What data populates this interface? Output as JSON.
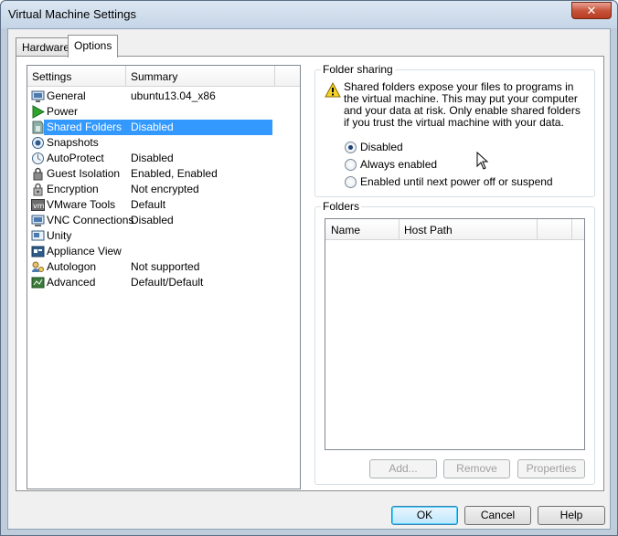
{
  "window": {
    "title": "Virtual Machine Settings",
    "close_glyph": "✕"
  },
  "tabs": [
    {
      "label": "Hardware",
      "active": false
    },
    {
      "label": "Options",
      "active": true
    }
  ],
  "settings": {
    "headers": {
      "settings": "Settings",
      "summary": "Summary"
    },
    "items": [
      {
        "label": "General",
        "summary": "ubuntu13.04_x86",
        "icon": "general-icon"
      },
      {
        "label": "Power",
        "summary": "",
        "icon": "power-icon"
      },
      {
        "label": "Shared Folders",
        "summary": "Disabled",
        "icon": "shared-folders-icon",
        "selected": true
      },
      {
        "label": "Snapshots",
        "summary": "",
        "icon": "snapshots-icon"
      },
      {
        "label": "AutoProtect",
        "summary": "Disabled",
        "icon": "autoprotect-icon"
      },
      {
        "label": "Guest Isolation",
        "summary": "Enabled, Enabled",
        "icon": "guest-isolation-icon"
      },
      {
        "label": "Encryption",
        "summary": "Not encrypted",
        "icon": "encryption-icon"
      },
      {
        "label": "VMware Tools",
        "summary": "Default",
        "icon": "vmware-tools-icon"
      },
      {
        "label": "VNC Connections",
        "summary": "Disabled",
        "icon": "vnc-icon"
      },
      {
        "label": "Unity",
        "summary": "",
        "icon": "unity-icon"
      },
      {
        "label": "Appliance View",
        "summary": "",
        "icon": "appliance-view-icon"
      },
      {
        "label": "Autologon",
        "summary": "Not supported",
        "icon": "autologon-icon"
      },
      {
        "label": "Advanced",
        "summary": "Default/Default",
        "icon": "advanced-icon"
      }
    ]
  },
  "folder_sharing": {
    "title": "Folder sharing",
    "warning": "Shared folders expose your files to programs in the virtual machine. This may put your computer and your data at risk. Only enable shared folders if you trust the virtual machine with your data.",
    "options": [
      {
        "label": "Disabled",
        "checked": true
      },
      {
        "label": "Always enabled",
        "checked": false
      },
      {
        "label": "Enabled until next power off or suspend",
        "checked": false
      }
    ]
  },
  "folders": {
    "title": "Folders",
    "columns": [
      "Name",
      "Host Path"
    ],
    "buttons": {
      "add": "Add...",
      "remove": "Remove",
      "properties": "Properties"
    }
  },
  "footer": {
    "ok": "OK",
    "cancel": "Cancel",
    "help": "Help"
  }
}
